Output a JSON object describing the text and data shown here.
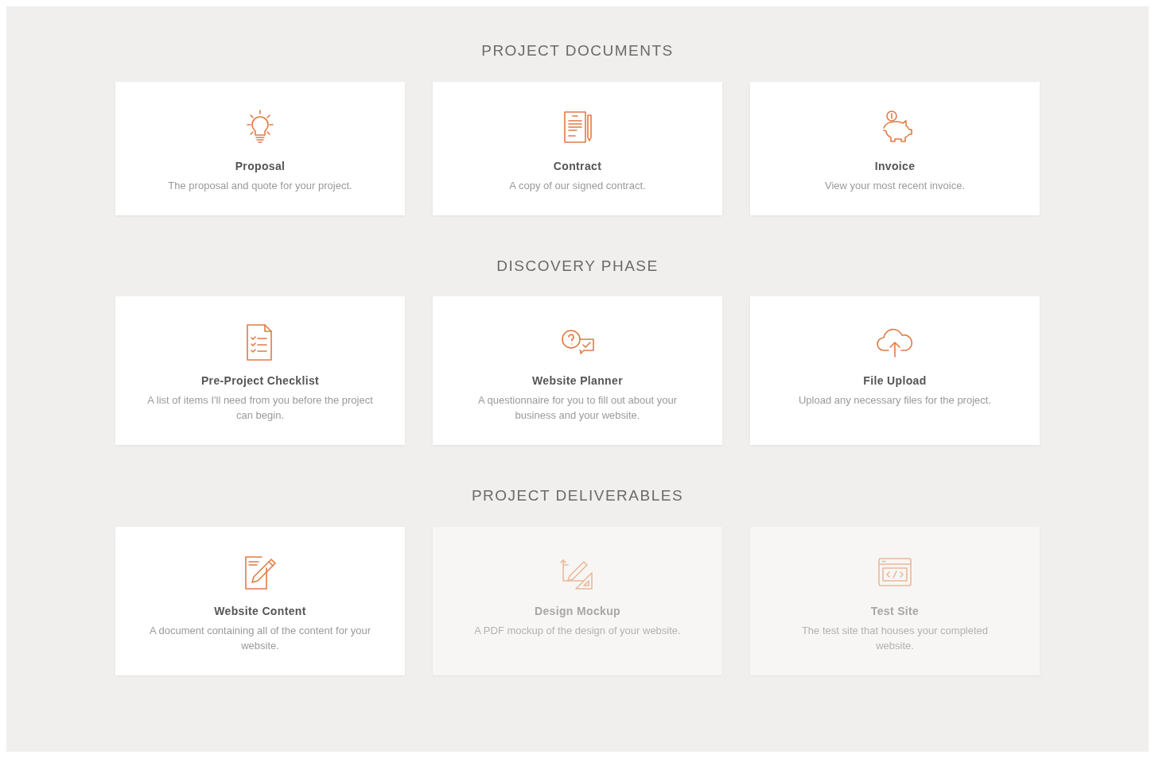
{
  "sections": [
    {
      "title": "PROJECT DOCUMENTS",
      "cards": [
        {
          "kind": "bulb",
          "title": "Proposal",
          "description": "The proposal and quote for your project.",
          "disabled": false
        },
        {
          "kind": "contract",
          "title": "Contract",
          "description": "A copy of our signed contract.",
          "disabled": false
        },
        {
          "kind": "piggy",
          "title": "Invoice",
          "description": "View your most recent invoice.",
          "disabled": false
        }
      ]
    },
    {
      "title": "DISCOVERY PHASE",
      "cards": [
        {
          "kind": "checklist",
          "title": "Pre-Project Checklist",
          "description": "A list of items I'll need from you before the project can begin.",
          "disabled": false
        },
        {
          "kind": "chat",
          "title": "Website Planner",
          "description": "A questionnaire for you to fill out about your business and your website.",
          "disabled": false
        },
        {
          "kind": "cloud",
          "title": "File Upload",
          "description": "Upload any necessary files for the project.",
          "disabled": false
        }
      ]
    },
    {
      "title": "PROJECT DELIVERABLES",
      "cards": [
        {
          "kind": "pencil",
          "title": "Website Content",
          "description": "A document containing all of the content for your website.",
          "disabled": false
        },
        {
          "kind": "mockup",
          "title": "Design Mockup",
          "description": "A PDF mockup of the design of your website.",
          "disabled": true
        },
        {
          "kind": "code",
          "title": "Test Site",
          "description": "The test site that houses your completed website.",
          "disabled": true
        }
      ]
    }
  ]
}
